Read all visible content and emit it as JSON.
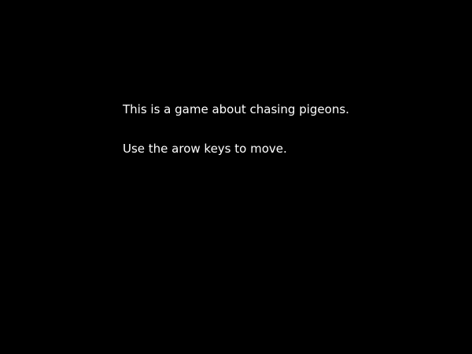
{
  "screen": {
    "background_color": "#000000",
    "text_color": "#ffffff"
  },
  "intro": {
    "lines": [
      "This is a game about chasing pigeons.",
      "Use the arow keys to move."
    ]
  }
}
